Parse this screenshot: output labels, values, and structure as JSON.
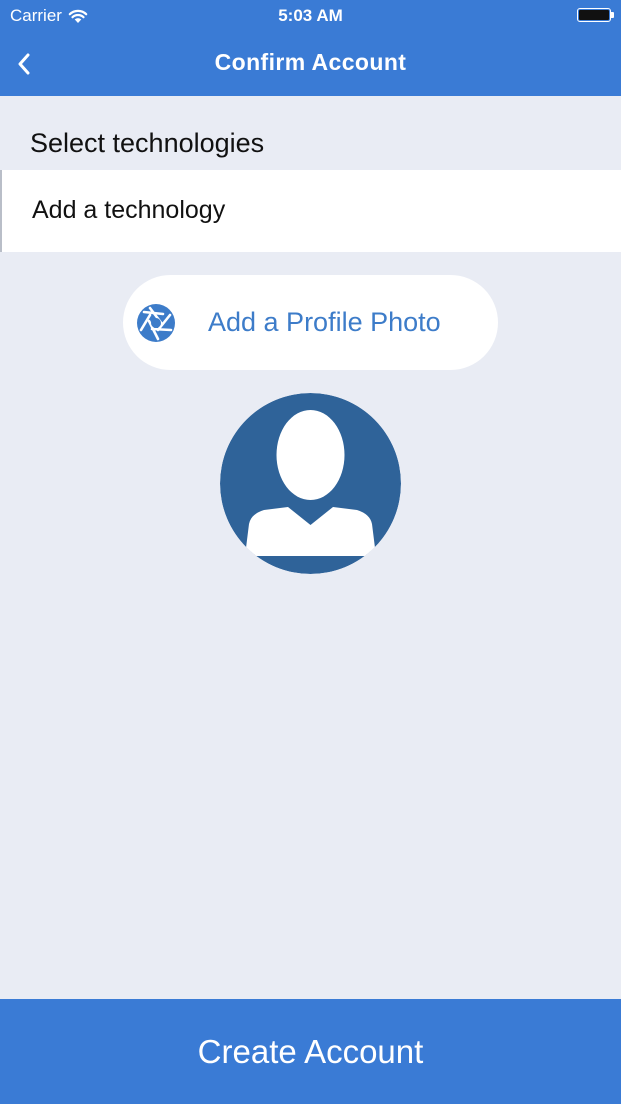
{
  "status_bar": {
    "carrier": "Carrier",
    "time": "5:03 AM"
  },
  "nav": {
    "title": "Confirm Account",
    "back_icon": "chevron-left-icon"
  },
  "technologies": {
    "section_label": "Select technologies",
    "field_placeholder": "Add a technology"
  },
  "profile_photo": {
    "button_label": "Add a Profile Photo",
    "icon": "camera-aperture-icon",
    "avatar": "user-placeholder-avatar"
  },
  "footer": {
    "create_label": "Create Account"
  },
  "colors": {
    "primary": "#3A7BD5",
    "background": "#E9ECF4",
    "avatar": "#2F6399",
    "link_text": "#3D7CC9"
  }
}
